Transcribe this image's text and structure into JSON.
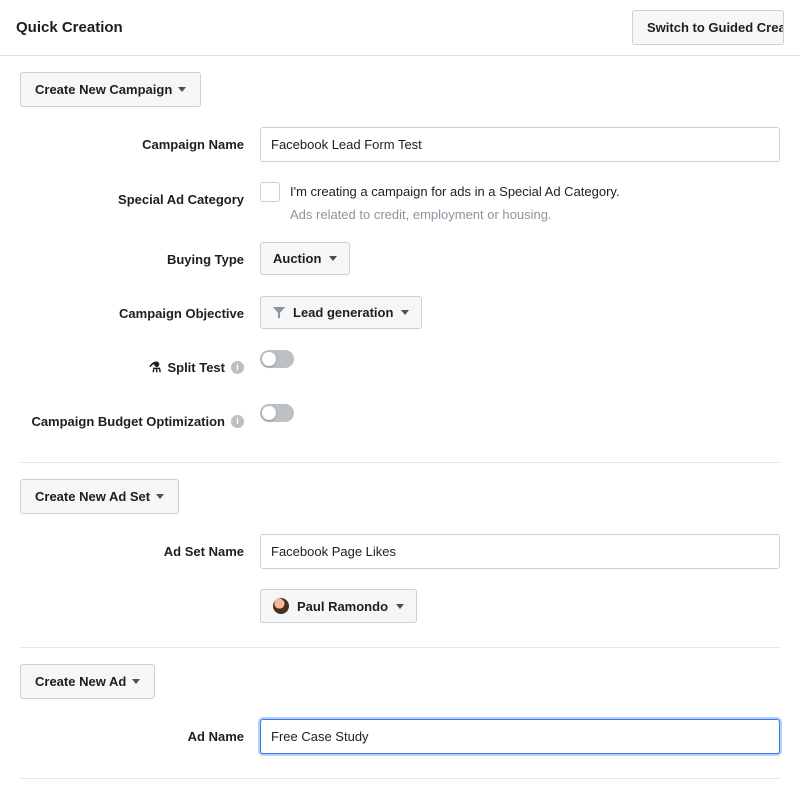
{
  "header": {
    "title": "Quick Creation",
    "switch_button": "Switch to Guided Creation"
  },
  "campaign": {
    "create_button": "Create New Campaign",
    "name_label": "Campaign Name",
    "name_value": "Facebook Lead Form Test",
    "special_cat_label": "Special Ad Category",
    "special_cat_text": "I'm creating a campaign for ads in a Special Ad Category.",
    "special_cat_help": "Ads related to credit, employment or housing.",
    "buying_type_label": "Buying Type",
    "buying_type_value": "Auction",
    "objective_label": "Campaign Objective",
    "objective_value": "Lead generation",
    "split_test_label": "Split Test",
    "budget_opt_label": "Campaign Budget Optimization"
  },
  "adset": {
    "create_button": "Create New Ad Set",
    "name_label": "Ad Set Name",
    "name_value": "Facebook Page Likes",
    "page_value": "Paul Ramondo"
  },
  "ad": {
    "create_button": "Create New Ad",
    "name_label": "Ad Name",
    "name_value": "Free Case Study"
  }
}
